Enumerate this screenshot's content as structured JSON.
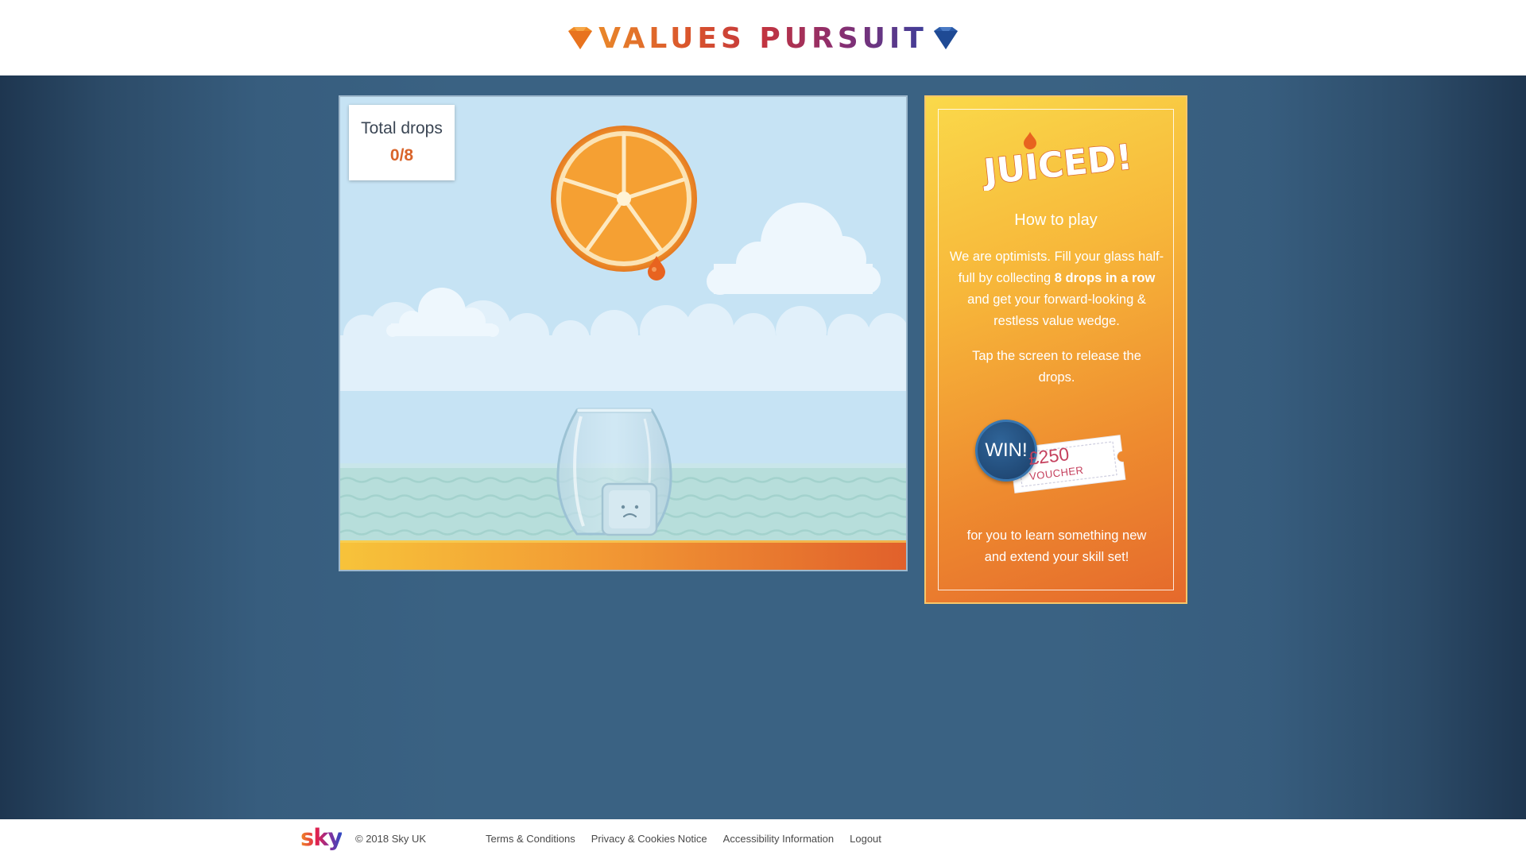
{
  "header": {
    "logo_text": "VALUES PURSUIT",
    "left_gem_color": "#f08a25",
    "right_gem_color": "#2a5aa8"
  },
  "game": {
    "drops_label": "Total drops",
    "drops_count": "0/8",
    "drops_collected": 0,
    "drops_target": 8,
    "sky_color": "#c6e3f4",
    "sea_color": "#b7dedb",
    "ground_color": "#f2a136"
  },
  "panel": {
    "brand_title": "JUICED!",
    "how_to_play": "How to play",
    "description_part1": "We are optimists. Fill your glass half-full by collecting ",
    "description_bold": "8 drops in a row",
    "description_part2": " and get your forward-looking & restless value wedge.",
    "tap_instruction": "Tap the screen to release the drops.",
    "win_label": "WIN!",
    "voucher_amount": "£250",
    "voucher_label": "VOUCHER",
    "learn_text": "for you to learn something new and extend your skill set!"
  },
  "footer": {
    "logo_text": "sky",
    "copyright": "© 2018 Sky UK",
    "links": [
      "Terms & Conditions",
      "Privacy & Cookies Notice",
      "Accessibility Information",
      "Logout"
    ]
  }
}
